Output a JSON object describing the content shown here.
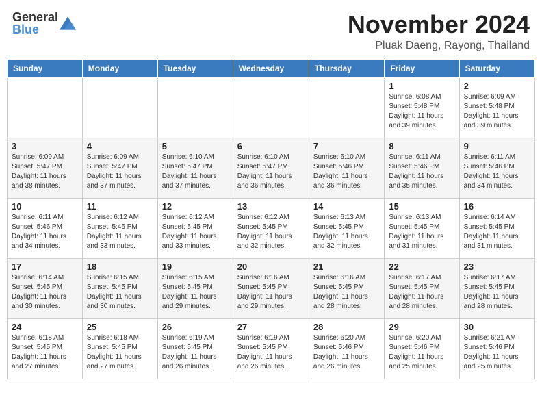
{
  "header": {
    "logo_general": "General",
    "logo_blue": "Blue",
    "month_title": "November 2024",
    "location": "Pluak Daeng, Rayong, Thailand"
  },
  "weekdays": [
    "Sunday",
    "Monday",
    "Tuesday",
    "Wednesday",
    "Thursday",
    "Friday",
    "Saturday"
  ],
  "weeks": [
    [
      {
        "day": "",
        "info": ""
      },
      {
        "day": "",
        "info": ""
      },
      {
        "day": "",
        "info": ""
      },
      {
        "day": "",
        "info": ""
      },
      {
        "day": "",
        "info": ""
      },
      {
        "day": "1",
        "info": "Sunrise: 6:08 AM\nSunset: 5:48 PM\nDaylight: 11 hours\nand 39 minutes."
      },
      {
        "day": "2",
        "info": "Sunrise: 6:09 AM\nSunset: 5:48 PM\nDaylight: 11 hours\nand 39 minutes."
      }
    ],
    [
      {
        "day": "3",
        "info": "Sunrise: 6:09 AM\nSunset: 5:47 PM\nDaylight: 11 hours\nand 38 minutes."
      },
      {
        "day": "4",
        "info": "Sunrise: 6:09 AM\nSunset: 5:47 PM\nDaylight: 11 hours\nand 37 minutes."
      },
      {
        "day": "5",
        "info": "Sunrise: 6:10 AM\nSunset: 5:47 PM\nDaylight: 11 hours\nand 37 minutes."
      },
      {
        "day": "6",
        "info": "Sunrise: 6:10 AM\nSunset: 5:47 PM\nDaylight: 11 hours\nand 36 minutes."
      },
      {
        "day": "7",
        "info": "Sunrise: 6:10 AM\nSunset: 5:46 PM\nDaylight: 11 hours\nand 36 minutes."
      },
      {
        "day": "8",
        "info": "Sunrise: 6:11 AM\nSunset: 5:46 PM\nDaylight: 11 hours\nand 35 minutes."
      },
      {
        "day": "9",
        "info": "Sunrise: 6:11 AM\nSunset: 5:46 PM\nDaylight: 11 hours\nand 34 minutes."
      }
    ],
    [
      {
        "day": "10",
        "info": "Sunrise: 6:11 AM\nSunset: 5:46 PM\nDaylight: 11 hours\nand 34 minutes."
      },
      {
        "day": "11",
        "info": "Sunrise: 6:12 AM\nSunset: 5:46 PM\nDaylight: 11 hours\nand 33 minutes."
      },
      {
        "day": "12",
        "info": "Sunrise: 6:12 AM\nSunset: 5:45 PM\nDaylight: 11 hours\nand 33 minutes."
      },
      {
        "day": "13",
        "info": "Sunrise: 6:12 AM\nSunset: 5:45 PM\nDaylight: 11 hours\nand 32 minutes."
      },
      {
        "day": "14",
        "info": "Sunrise: 6:13 AM\nSunset: 5:45 PM\nDaylight: 11 hours\nand 32 minutes."
      },
      {
        "day": "15",
        "info": "Sunrise: 6:13 AM\nSunset: 5:45 PM\nDaylight: 11 hours\nand 31 minutes."
      },
      {
        "day": "16",
        "info": "Sunrise: 6:14 AM\nSunset: 5:45 PM\nDaylight: 11 hours\nand 31 minutes."
      }
    ],
    [
      {
        "day": "17",
        "info": "Sunrise: 6:14 AM\nSunset: 5:45 PM\nDaylight: 11 hours\nand 30 minutes."
      },
      {
        "day": "18",
        "info": "Sunrise: 6:15 AM\nSunset: 5:45 PM\nDaylight: 11 hours\nand 30 minutes."
      },
      {
        "day": "19",
        "info": "Sunrise: 6:15 AM\nSunset: 5:45 PM\nDaylight: 11 hours\nand 29 minutes."
      },
      {
        "day": "20",
        "info": "Sunrise: 6:16 AM\nSunset: 5:45 PM\nDaylight: 11 hours\nand 29 minutes."
      },
      {
        "day": "21",
        "info": "Sunrise: 6:16 AM\nSunset: 5:45 PM\nDaylight: 11 hours\nand 28 minutes."
      },
      {
        "day": "22",
        "info": "Sunrise: 6:17 AM\nSunset: 5:45 PM\nDaylight: 11 hours\nand 28 minutes."
      },
      {
        "day": "23",
        "info": "Sunrise: 6:17 AM\nSunset: 5:45 PM\nDaylight: 11 hours\nand 28 minutes."
      }
    ],
    [
      {
        "day": "24",
        "info": "Sunrise: 6:18 AM\nSunset: 5:45 PM\nDaylight: 11 hours\nand 27 minutes."
      },
      {
        "day": "25",
        "info": "Sunrise: 6:18 AM\nSunset: 5:45 PM\nDaylight: 11 hours\nand 27 minutes."
      },
      {
        "day": "26",
        "info": "Sunrise: 6:19 AM\nSunset: 5:45 PM\nDaylight: 11 hours\nand 26 minutes."
      },
      {
        "day": "27",
        "info": "Sunrise: 6:19 AM\nSunset: 5:45 PM\nDaylight: 11 hours\nand 26 minutes."
      },
      {
        "day": "28",
        "info": "Sunrise: 6:20 AM\nSunset: 5:46 PM\nDaylight: 11 hours\nand 26 minutes."
      },
      {
        "day": "29",
        "info": "Sunrise: 6:20 AM\nSunset: 5:46 PM\nDaylight: 11 hours\nand 25 minutes."
      },
      {
        "day": "30",
        "info": "Sunrise: 6:21 AM\nSunset: 5:46 PM\nDaylight: 11 hours\nand 25 minutes."
      }
    ]
  ]
}
